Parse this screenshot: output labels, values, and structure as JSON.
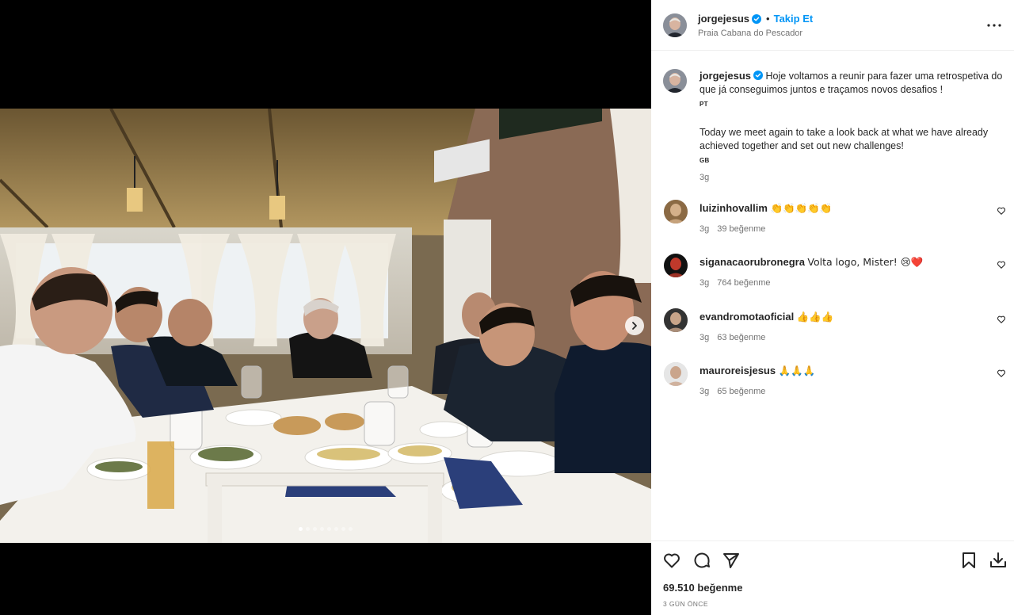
{
  "post": {
    "username": "jorgejesus",
    "follow_label": "Takip Et",
    "location": "Praia Cabana do Pescador",
    "caption_pt": "Hoje voltamos a reunir para fazer uma retrospetiva do que já conseguimos juntos e traçamos novos desafios !",
    "flag_pt": "PT",
    "caption_en": "Today we meet again to take a look back at what we have already achieved together and set out new challenges!",
    "flag_en": "GB",
    "caption_time": "3g",
    "likes": "69.510 beğenme",
    "posted": "3 GÜN ÖNCE"
  },
  "comments": [
    {
      "user": "luizinhovallim",
      "text": "👏👏👏👏👏",
      "time": "3g",
      "likes": "39 beğenme"
    },
    {
      "user": "siganacaorubronegra",
      "text": "Volta logo, Mister! 😢❤️",
      "time": "3g",
      "likes": "764 beğenme"
    },
    {
      "user": "evandromotaoficial",
      "text": "👍👍👍",
      "time": "3g",
      "likes": "63 beğenme"
    },
    {
      "user": "mauroreisjesus",
      "text": "🙏🙏🙏",
      "time": "3g",
      "likes": "65 beğenme"
    }
  ],
  "carousel": {
    "total": 8,
    "active_index": 0
  },
  "icons": {
    "verified": "verified-badge-icon",
    "more": "more-options-icon",
    "like": "heart-icon",
    "comment": "comment-icon",
    "share": "share-icon",
    "save": "bookmark-icon",
    "download": "download-icon",
    "next": "chevron-right-icon"
  },
  "colors": {
    "accent": "#0095f6",
    "verified": "#0095f6",
    "heart_red": "#e0245e"
  }
}
